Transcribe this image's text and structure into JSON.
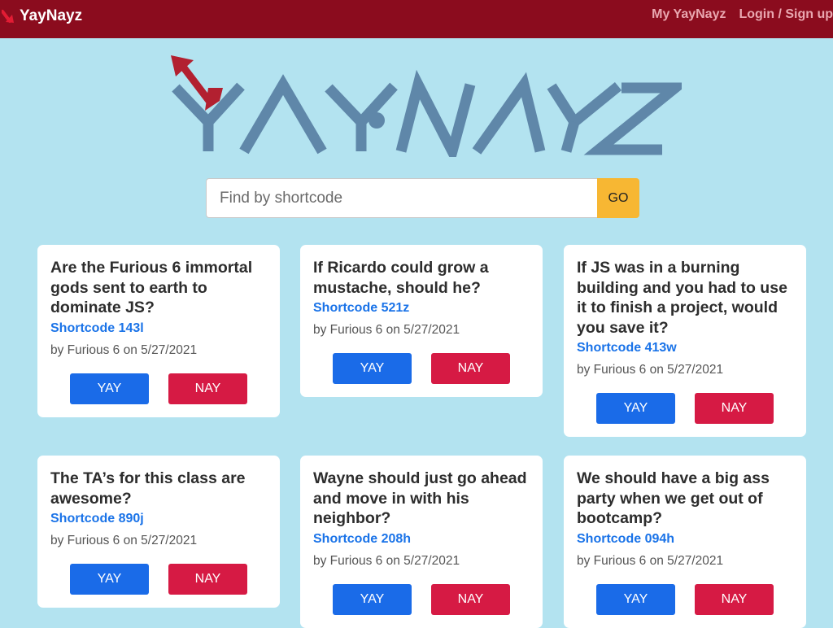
{
  "header": {
    "brand": "YayNayz",
    "nav": [
      "My YayNayz",
      "Login / Sign up"
    ]
  },
  "hero": {
    "logo_text": "YAY•NAYZ"
  },
  "search": {
    "placeholder": "Find by shortcode",
    "go_label": "GO"
  },
  "colors": {
    "header_bg": "#8b0c1e",
    "page_bg": "#b3e3f0",
    "logo_blue": "#5f87a9",
    "logo_red": "#b22030",
    "go_button": "#f7b733",
    "yay_button": "#1a6be8",
    "nay_button": "#d61a44",
    "shortcode_link": "#1a73e8"
  },
  "cards": [
    {
      "question": "Are the Furious 6 immortal gods sent to earth to dominate JS?",
      "shortcode": "Shortcode 143l",
      "byline": "by Furious 6 on 5/27/2021",
      "yay": "YAY",
      "nay": "NAY"
    },
    {
      "question": "If Ricardo could grow a mustache, should he?",
      "shortcode": "Shortcode 521z",
      "byline": "by Furious 6 on 5/27/2021",
      "yay": "YAY",
      "nay": "NAY"
    },
    {
      "question": "If JS was in a burning building and you had to use it to finish a project, would you save it?",
      "shortcode": "Shortcode 413w",
      "byline": "by Furious 6 on 5/27/2021",
      "yay": "YAY",
      "nay": "NAY"
    },
    {
      "question": "The TA’s for this class are awesome?",
      "shortcode": "Shortcode 890j",
      "byline": "by Furious 6 on 5/27/2021",
      "yay": "YAY",
      "nay": "NAY"
    },
    {
      "question": "Wayne should just go ahead and move in with his neighbor?",
      "shortcode": "Shortcode 208h",
      "byline": "by Furious 6 on 5/27/2021",
      "yay": "YAY",
      "nay": "NAY"
    },
    {
      "question": "We should have a big ass party when we get out of bootcamp?",
      "shortcode": "Shortcode 094h",
      "byline": "by Furious 6 on 5/27/2021",
      "yay": "YAY",
      "nay": "NAY"
    }
  ]
}
